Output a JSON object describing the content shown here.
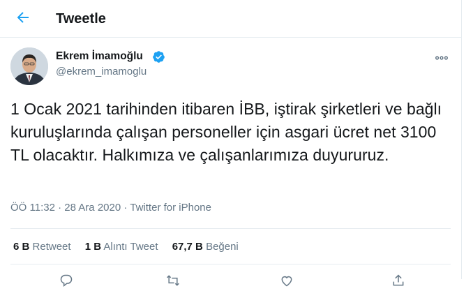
{
  "header": {
    "title": "Tweetle"
  },
  "tweet": {
    "author_name": "Ekrem İmamoğlu",
    "handle": "@ekrem_imamoglu",
    "text": "1 Ocak 2021 tarihinden itibaren İBB, iştirak şirketleri ve bağlı kuruluşlarında çalışan personeller için asgari ücret net 3100 TL olacaktır. Halkımıza ve çalışanlarımıza duyururuz.",
    "time": "ÖÖ 11:32",
    "dot1": "·",
    "date": "28 Ara 2020",
    "dot2": "·",
    "source": "Twitter for iPhone"
  },
  "stats": {
    "retweet_count": "6 B",
    "retweet_label": "Retweet",
    "quote_count": "1 B",
    "quote_label": "Alıntı Tweet",
    "like_count": "67,7 B",
    "like_label": "Beğeni"
  },
  "colors": {
    "accent": "#1da1f2",
    "muted": "#657786",
    "border": "#e6ecf0"
  },
  "icons": [
    "back-arrow-icon",
    "verified-badge-icon",
    "more-icon",
    "reply-icon",
    "retweet-icon",
    "like-icon",
    "share-icon"
  ]
}
